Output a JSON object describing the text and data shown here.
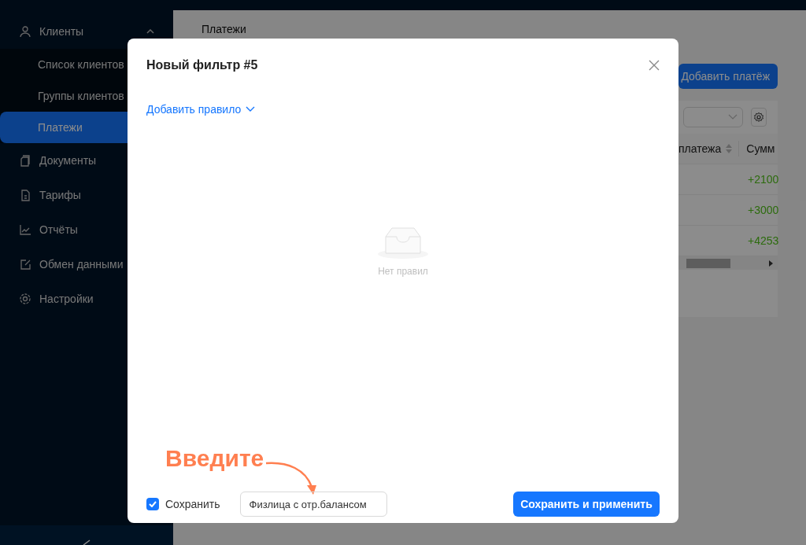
{
  "sidebar": {
    "items": [
      {
        "label": "Клиенты",
        "expanded": true,
        "children": [
          {
            "label": "Список клиентов",
            "selected": false
          },
          {
            "label": "Группы клиентов",
            "selected": false
          },
          {
            "label": "Платежи",
            "selected": true
          }
        ]
      },
      {
        "label": "Документы",
        "selected": false
      },
      {
        "label": "Тарифы",
        "selected": false
      },
      {
        "label": "Отчёты",
        "selected": false
      },
      {
        "label": "Обмен данными",
        "selected": false
      },
      {
        "label": "Настройки",
        "selected": false
      }
    ]
  },
  "page": {
    "breadcrumb": "Платежи",
    "add_button": "Добавить платёж",
    "table": {
      "columns": [
        "платежа",
        "Сумм"
      ],
      "rows": [
        [
          "",
          "+2100"
        ],
        [
          "",
          "+3000"
        ],
        [
          "",
          "+4253"
        ]
      ]
    }
  },
  "modal": {
    "title": "Новый фильтр #5",
    "add_rule": "Добавить правило",
    "empty_text": "Нет правил",
    "annotation": "Введите",
    "save_checkbox": {
      "label": "Сохранить",
      "checked": true
    },
    "name_field": {
      "value": "Физлица с отр.балансом"
    },
    "primary_button": "Сохранить и применить"
  }
}
